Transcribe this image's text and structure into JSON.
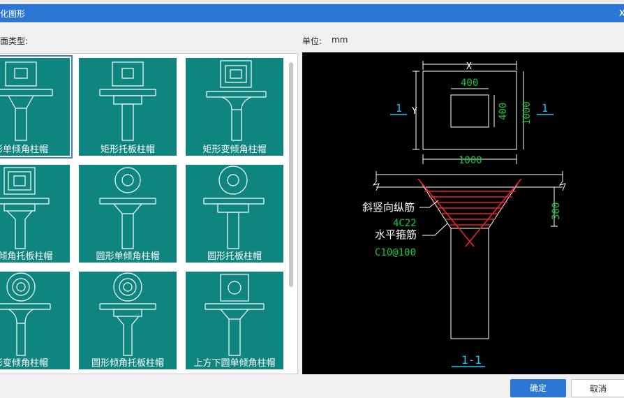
{
  "window": {
    "title": "化图形",
    "close_glyph": "x"
  },
  "labels": {
    "section_type": "面类型:",
    "unit_label": "单位:",
    "unit_value": "mm"
  },
  "tiles": [
    {
      "caption": "形单倾角柱帽",
      "selected": true
    },
    {
      "caption": "矩形托板柱帽",
      "selected": false
    },
    {
      "caption": "矩形变倾角柱帽",
      "selected": false
    },
    {
      "caption": "形倾角托板柱帽",
      "selected": false
    },
    {
      "caption": "圆形单倾角柱帽",
      "selected": false
    },
    {
      "caption": "圆形托板柱帽",
      "selected": false
    },
    {
      "caption": "形变倾角柱帽",
      "selected": false
    },
    {
      "caption": "圆形倾角托板柱帽",
      "selected": false
    },
    {
      "caption": "上方下圆单倾角柱帽",
      "selected": false
    }
  ],
  "preview": {
    "dim_x": "X",
    "dim_y": "Y",
    "dim_inner_w": "400",
    "dim_inner_h": "400",
    "dim_outer_h": "1000",
    "dim_outer_w": "1000",
    "section_mark_left": "1",
    "section_mark_right": "1",
    "dim_cap_depth": "300",
    "label_slanted_rebar": "斜竖向纵筋",
    "value_slanted_rebar": "4C22",
    "label_stirrup": "水平箍筋",
    "value_stirrup": "C10@100",
    "section_title": "1-1"
  },
  "buttons": {
    "ok": "确定",
    "cancel": "取消"
  },
  "colors": {
    "accent": "#2c77d6",
    "tile_bg": "#0f8580",
    "dim_green": "#19c93a",
    "mark_cyan": "#1ec8ff",
    "rebar_red": "#e8232a"
  }
}
